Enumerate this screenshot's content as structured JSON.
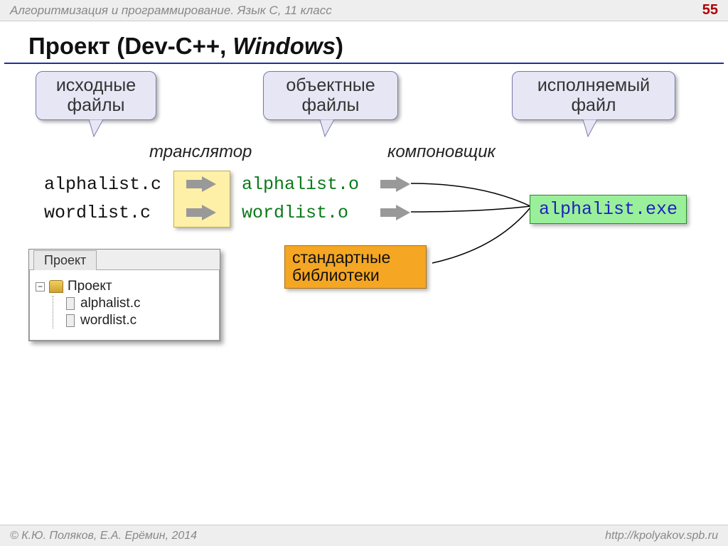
{
  "header": {
    "course": "Алгоритмизация и программирование. Язык С, 11 класс",
    "page": "55"
  },
  "title": {
    "prefix": "Проект (Dev-C++, ",
    "italic": "Windows",
    "suffix": ")"
  },
  "callouts": {
    "source": "исходные\nфайлы",
    "object": "объектные\nфайлы",
    "exe": "исполняемый\nфайл"
  },
  "stages": {
    "translator": "транслятор",
    "linker": "компоновщик"
  },
  "files": {
    "src1": "alphalist.c",
    "src2": "wordlist.c",
    "obj1": "alphalist.o",
    "obj2": "wordlist.o",
    "exe": "alphalist.exe"
  },
  "stdlib": "стандартные\nбиблиотеки",
  "project_panel": {
    "tab": "Проект",
    "root": "Проект",
    "children": [
      "alphalist.c",
      "wordlist.c"
    ]
  },
  "footer": {
    "left": "© К.Ю. Поляков, Е.А. Ерёмин, 2014",
    "right": "http://kpolyakov.spb.ru"
  }
}
